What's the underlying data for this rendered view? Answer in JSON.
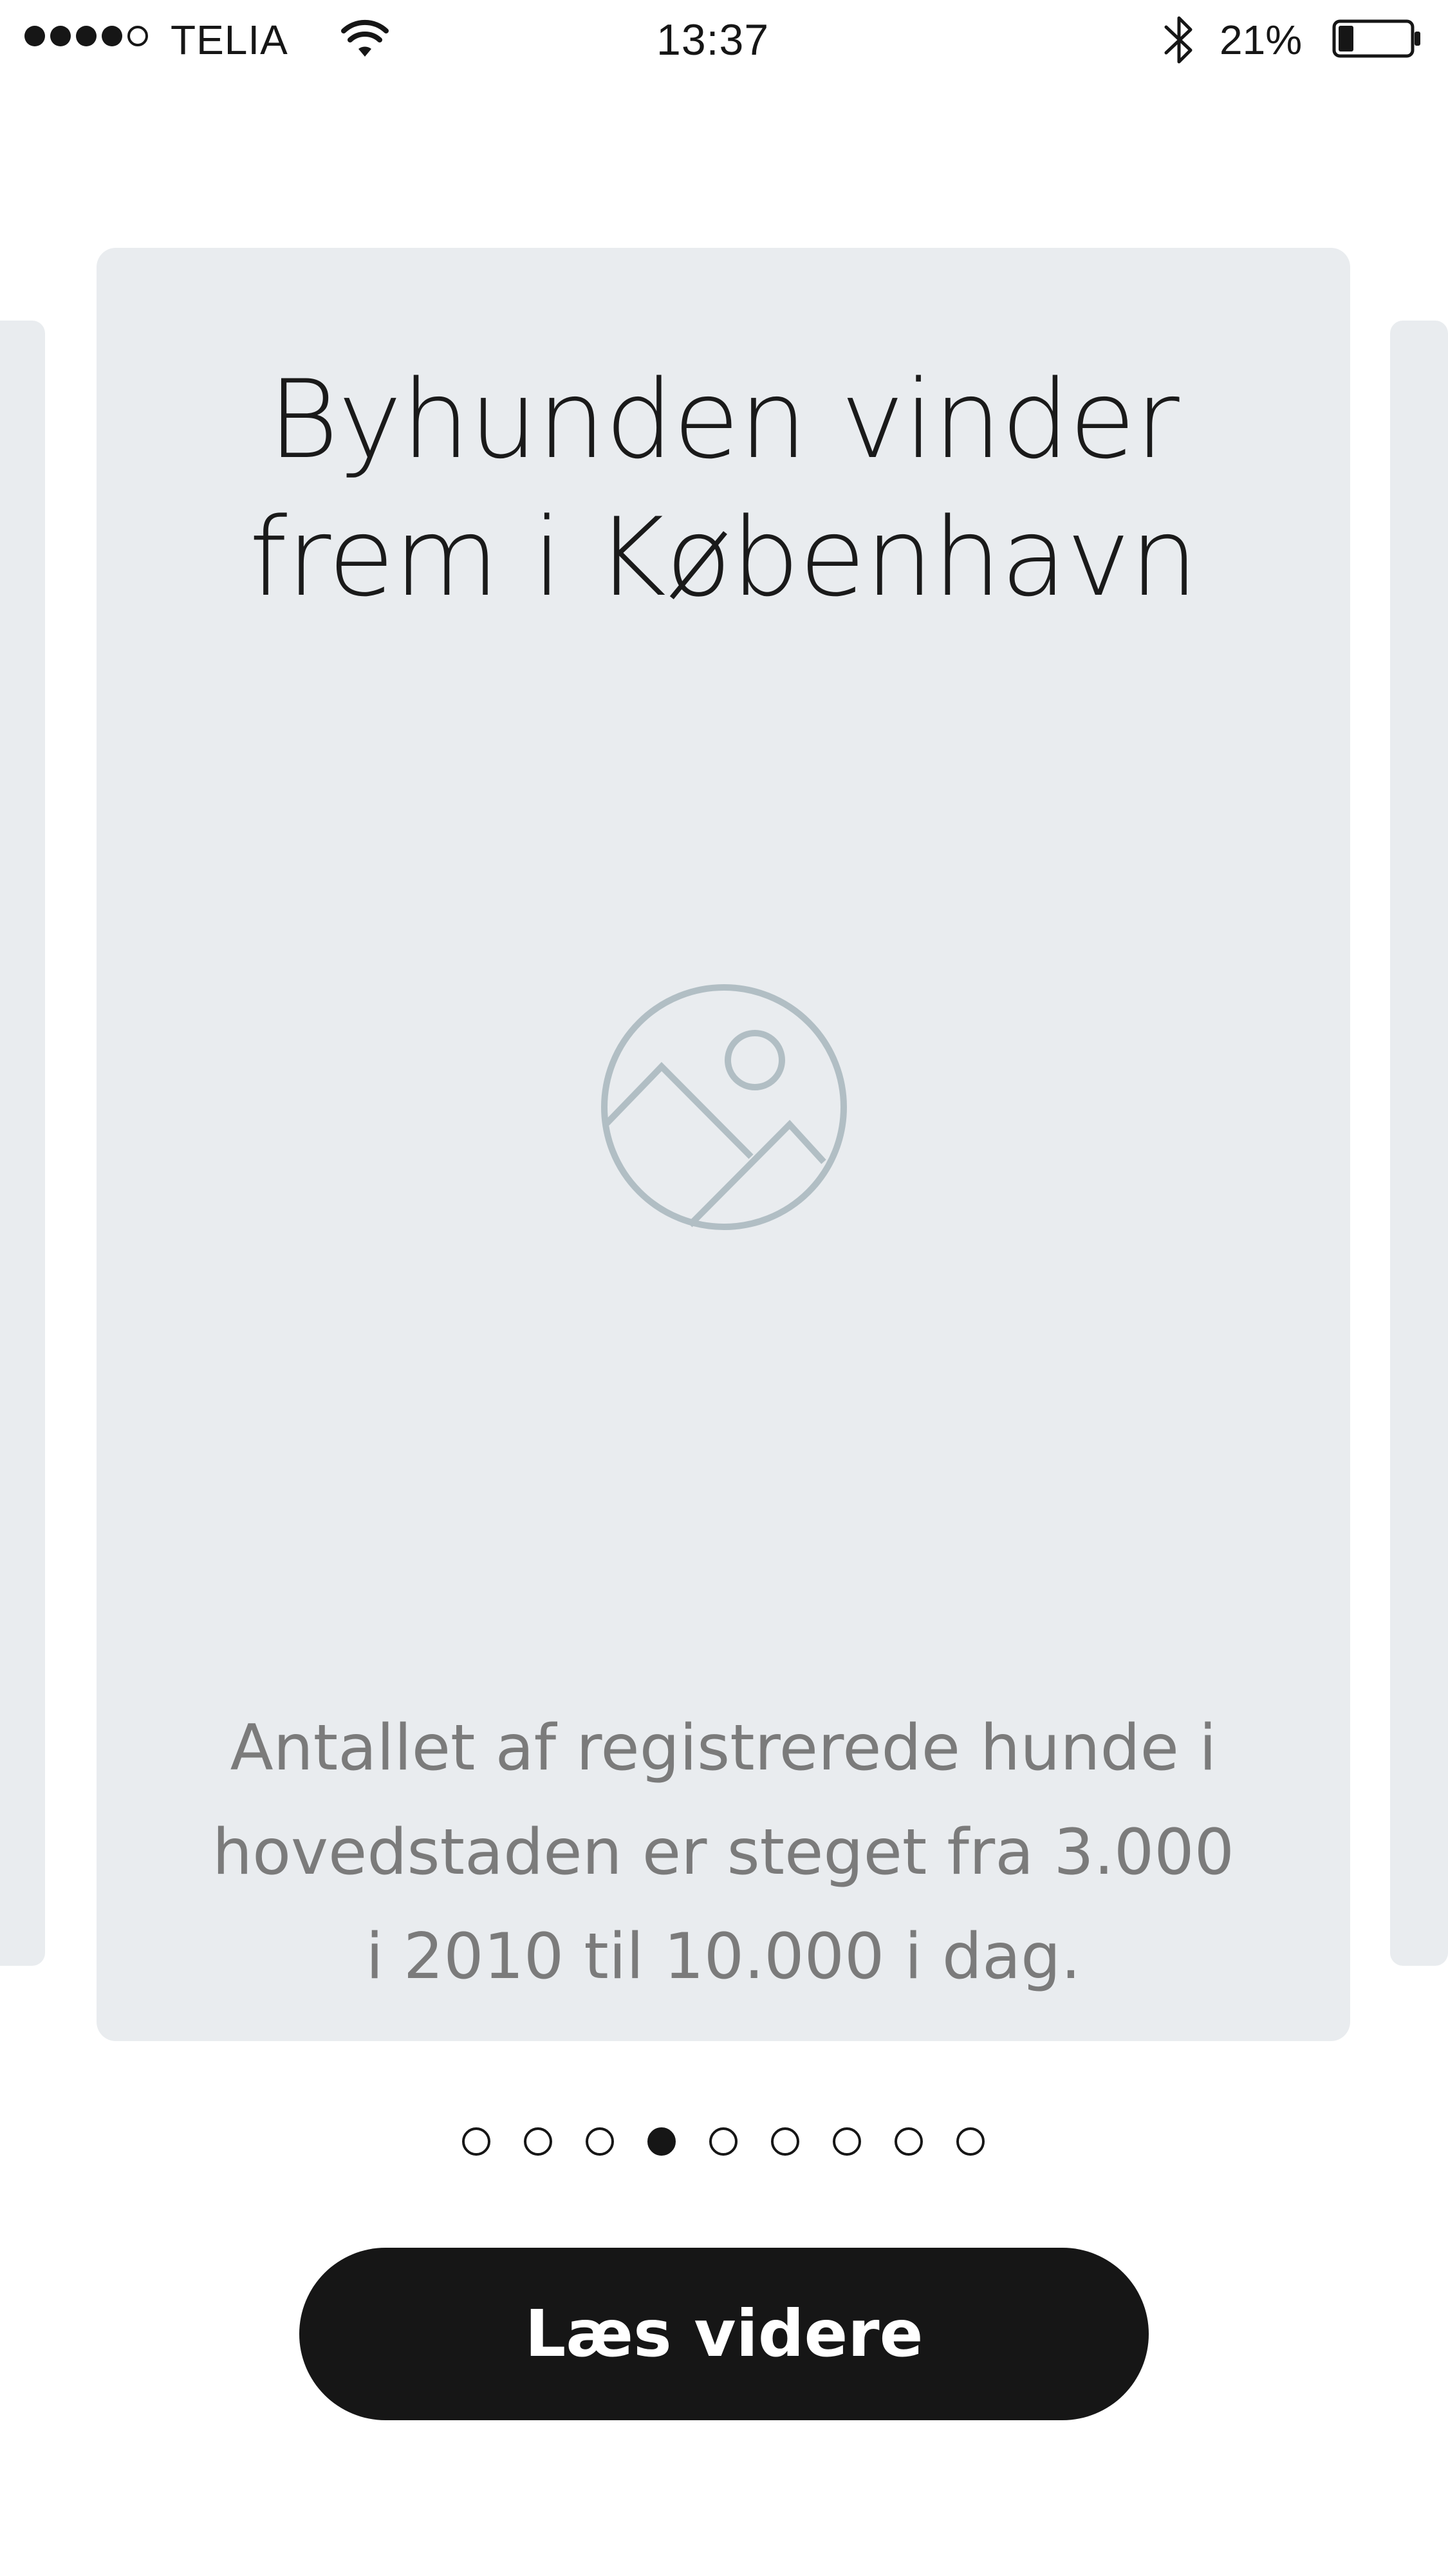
{
  "status_bar": {
    "carrier": "TELIA",
    "time": "13:37",
    "battery_percent": "21%",
    "battery_level": 0.21,
    "signal_bars_filled": 4,
    "signal_bars_total": 5,
    "icons": [
      "wifi-icon",
      "bluetooth-icon",
      "battery-icon"
    ]
  },
  "carousel": {
    "active_index": 3,
    "total": 9,
    "card": {
      "title_line1": "Byhunden vinder",
      "title_line2": "frem i København",
      "image_icon": "image-placeholder-icon",
      "description_line1": "Antallet af registrerede hunde i",
      "description_line2": "hovedstaden er steget fra 3.000",
      "description_line3": "i 2010 til 10.000 i dag."
    }
  },
  "cta": {
    "label": "Læs videre"
  },
  "colors": {
    "card_background": "#e9ecef",
    "text_primary": "#161616",
    "text_secondary": "#7b7b7b",
    "icon_stroke": "#b1bec4",
    "button_background": "#161616",
    "button_text": "#ffffff"
  }
}
